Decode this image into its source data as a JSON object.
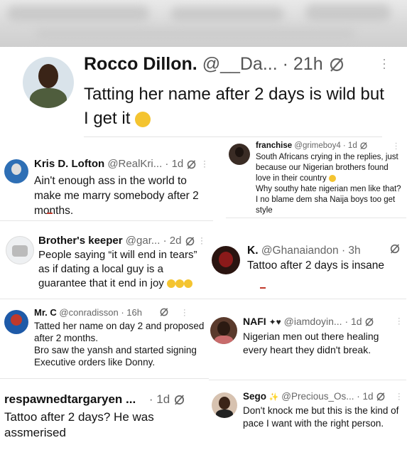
{
  "main_tweet": {
    "name": "Rocco Dillon.",
    "handle": "@__Da...",
    "time": "· 21h",
    "text": "Tatting her name after 2 days is wild but I get it"
  },
  "replies": [
    {
      "name": "Kris D. Lofton",
      "handle": "@RealKri...",
      "time": "· 1d",
      "text": "Ain't enough ass in the world to make me marry somebody after 2 months."
    },
    {
      "name": "franchise",
      "handle": "@grimeboy4 · 1d",
      "time": "",
      "text": "South Africans crying in the replies, just because our Nigerian brothers found love in their country"
    },
    {
      "name": "franchise_text2",
      "handle": "",
      "time": "",
      "text": "Why southy hate nigerian men like that? I no blame dem sha Naija boys too get style"
    },
    {
      "name": "Brother's keeper",
      "handle": "@gar...",
      "time": "· 2d",
      "text": "People saying “it will end in tears” as if dating a local guy is a guarantee that it end in joy"
    },
    {
      "name": "K.",
      "handle": "@Ghanaiandon",
      "time": "· 3h",
      "text": "Tattoo after 2 days is insane"
    },
    {
      "name": "Mr. C",
      "handle": "@conradisson",
      "time": "· 16h",
      "text": "Tatted her name on day 2 and proposed after 2 months."
    },
    {
      "name": "Mr. C text2",
      "handle": "",
      "time": "",
      "text": "Bro saw the yansh and started signing Executive orders like Donny."
    },
    {
      "name": "NAFI",
      "handle": "@iamdoyin...",
      "time": "· 1d",
      "text": "Nigerian men out there healing every heart they didn't break."
    },
    {
      "name": "respawnedtargaryen ...",
      "handle": "",
      "time": "· 1d",
      "text": "Tattoo after 2 days? He was assmerised"
    },
    {
      "name": "Sego",
      "handle": "@Precious_Os...",
      "time": "· 1d",
      "text": "Don't knock me but this is the kind of pace I want with the right person."
    }
  ],
  "icons": {
    "verified": "grok-slash-icon",
    "more": "more-dots-icon",
    "emoji_laugh": "joy-emoji",
    "emoji_hearts": "heart-emoji"
  }
}
